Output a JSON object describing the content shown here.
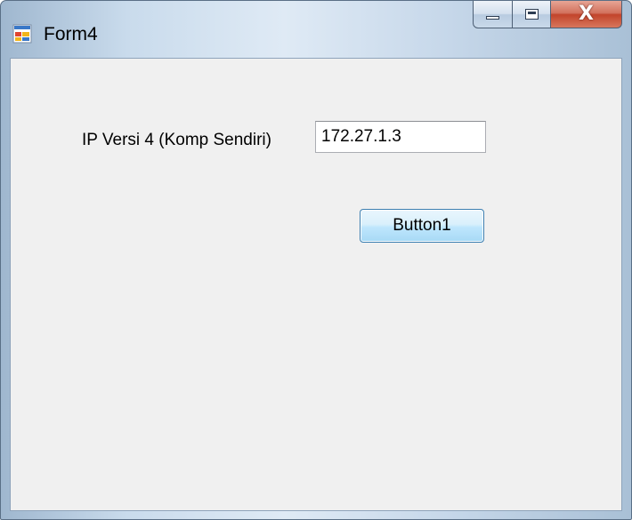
{
  "window": {
    "title": "Form4",
    "icon": "winforms-app-icon",
    "controls": {
      "minimize_icon": "minimize-icon",
      "maximize_icon": "maximize-icon",
      "close_label": "X"
    }
  },
  "form": {
    "ip_label": "IP Versi 4 (Komp Sendiri)",
    "ip_value": "172.27.1.3",
    "button1_label": "Button1"
  },
  "colors": {
    "client_bg": "#f0f0f0",
    "close_button": "#c2442b",
    "button_accent": "#3c7fb1"
  }
}
